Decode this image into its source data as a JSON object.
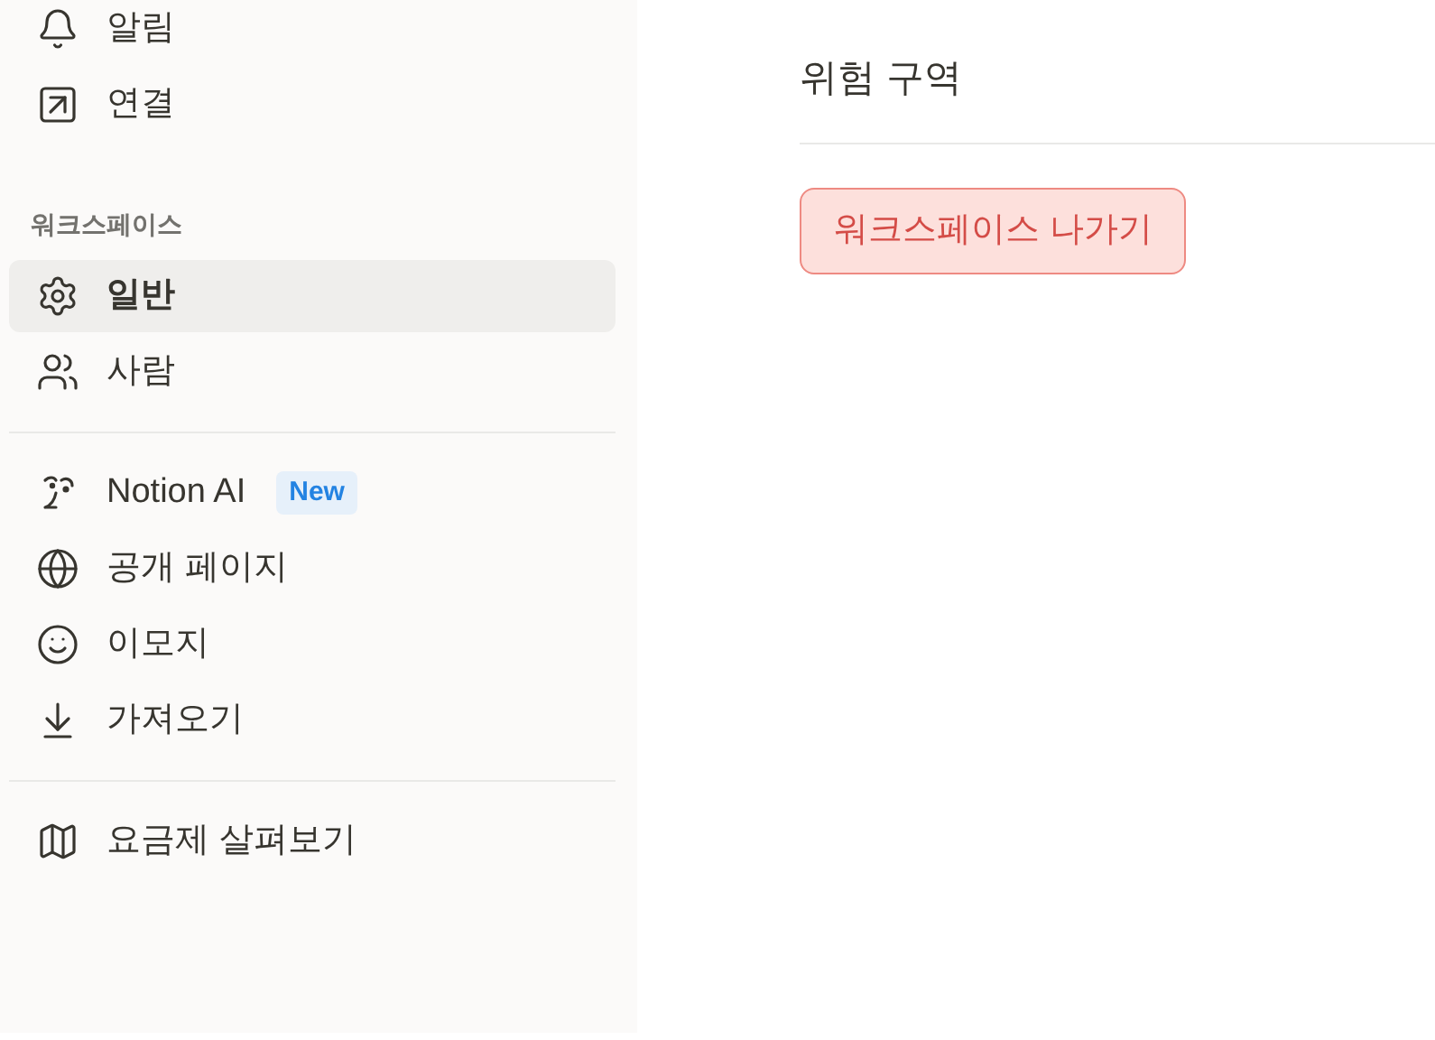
{
  "sidebar": {
    "groups": [
      {
        "items": [
          {
            "label": "알림",
            "selected": false
          },
          {
            "label": "연결",
            "selected": false
          }
        ]
      },
      {
        "heading": "워크스페이스",
        "items": [
          {
            "label": "일반",
            "selected": true
          },
          {
            "label": "사람",
            "selected": false
          }
        ]
      },
      {
        "items": [
          {
            "label": "Notion AI",
            "selected": false,
            "badge": "New"
          },
          {
            "label": "공개 페이지",
            "selected": false
          },
          {
            "label": "이모지",
            "selected": false
          },
          {
            "label": "가져오기",
            "selected": false
          }
        ]
      },
      {
        "items": [
          {
            "label": "요금제 살펴보기",
            "selected": false
          }
        ]
      }
    ]
  },
  "main": {
    "section_title": "위험 구역",
    "danger_button": "워크스페이스 나가기"
  }
}
